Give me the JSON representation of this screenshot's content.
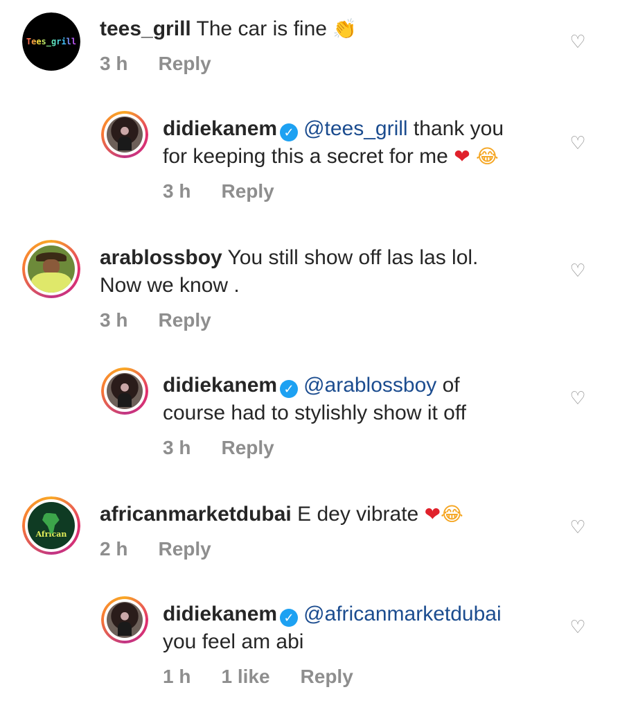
{
  "comments": [
    {
      "type": "top",
      "username": "tees_grill",
      "avatar_text": "Tees_grill",
      "text": "The car is fine",
      "emoji": "👏",
      "time": "3 h",
      "reply_label": "Reply"
    },
    {
      "type": "reply",
      "username": "didiekanem",
      "verified": true,
      "mention": "@tees_grill",
      "text_line1": "thank you",
      "text_line2": "for keeping this a secret for me",
      "emoji1": "❤",
      "emoji2": "😂",
      "time": "3 h",
      "reply_label": "Reply"
    },
    {
      "type": "top",
      "username": "arablossboy",
      "text_line1": "You still show off las las lol.",
      "text_line2": "Now we know .",
      "time": "3 h",
      "reply_label": "Reply"
    },
    {
      "type": "reply",
      "username": "didiekanem",
      "verified": true,
      "mention": "@arablossboy",
      "text_line1": "of",
      "text_line2": "course had to stylishly show it off",
      "time": "3 h",
      "reply_label": "Reply"
    },
    {
      "type": "top",
      "username": "africanmarketdubai",
      "avatar_text": "African",
      "text": "E dey vibrate",
      "emoji1": "❤",
      "emoji2": "😂",
      "time": "2 h",
      "reply_label": "Reply"
    },
    {
      "type": "reply",
      "username": "didiekanem",
      "verified": true,
      "mention": "@africanmarketdubai",
      "text_line2": "you feel am abi",
      "time": "1 h",
      "likes": "1 like",
      "reply_label": "Reply"
    }
  ],
  "icons": {
    "like": "heart-outline-icon",
    "verified": "verified-badge-icon"
  },
  "colors": {
    "mention": "#1b4c8f",
    "meta": "#8e8e8e",
    "verified": "#1da1f2"
  }
}
